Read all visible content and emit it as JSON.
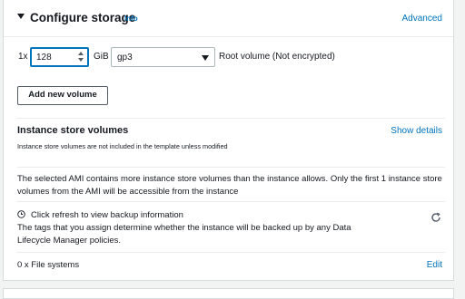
{
  "section": {
    "title": "Configure storage",
    "info_label": "Info",
    "advanced_label": "Advanced"
  },
  "volume_row": {
    "quantity_label": "1x",
    "size_value": "128",
    "unit_label": "GiB",
    "volume_type": "gp3",
    "root_volume_label": "Root volume  (Not encrypted)"
  },
  "add_button_label": "Add new volume",
  "instance_store": {
    "title": "Instance store volumes",
    "show_details_label": "Show details",
    "subtitle": "Instance store volumes are not included in the template unless modified",
    "warning": "The selected AMI contains more instance store volumes than the instance allows. Only the first 1 instance store volumes from the AMI will be accessible from the instance"
  },
  "backup": {
    "title": "Click refresh to view backup information",
    "description": "The tags that you assign determine whether the instance will be backed up by any Data Lifecycle Manager policies."
  },
  "file_systems": {
    "label": "0 x File systems",
    "edit_label": "Edit"
  },
  "colors": {
    "link": "#0073bb",
    "text": "#16191f",
    "focus_border": "#0073bb"
  }
}
